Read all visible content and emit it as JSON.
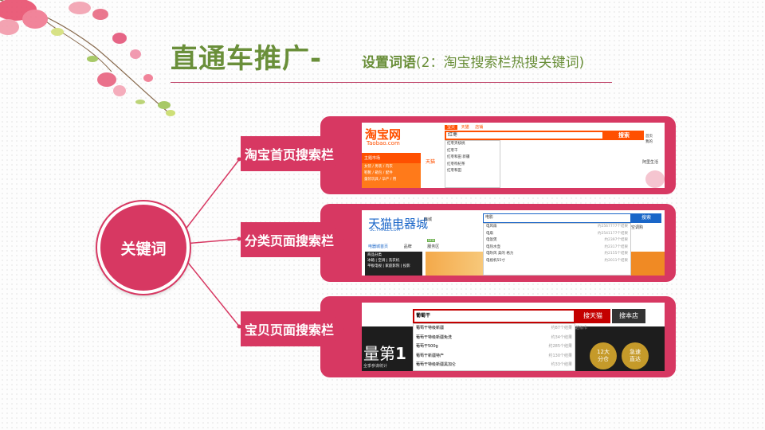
{
  "title": "直通车推广-",
  "subtitle": {
    "bold": "设置词语",
    "rest": "(2：淘宝搜索栏热搜关键词)"
  },
  "center": "关键词",
  "branches": [
    {
      "label": "淘宝首页搜索栏"
    },
    {
      "label": "分类页面搜索栏"
    },
    {
      "label": "宝贝页面搜索栏"
    }
  ],
  "shot1": {
    "logo": "淘宝网",
    "logo_sub": "Taobao.com",
    "tabs": [
      "宝贝",
      "天猫",
      "店铺"
    ],
    "query": "红枣",
    "button": "搜索",
    "side_title": "主题市场",
    "tmall": "天猫",
    "menu": [
      "女装 / 男装 / 内衣",
      "鞋靴 / 箱包 / 配件",
      "童装玩具 / 孕产 / 用"
    ],
    "suggestions": [
      "红枣夹核桃",
      "红枣干",
      "红枣和田 新疆",
      "红枣枸杞茶",
      "红枣和田"
    ],
    "right": [
      "首页",
      "我的"
    ],
    "right2": "阿里生活"
  },
  "shot2": {
    "logo": "天猫电器城",
    "logo_sub": "3C.TMALL.COM",
    "city": "商城",
    "query": "电影",
    "button": "搜索",
    "nav": [
      "电器城首页",
      "品牌",
      "服务区"
    ],
    "new_badge": "NEW",
    "side": "商品分类",
    "cats": [
      "冰箱 | 空调 | 洗衣机",
      "平板电视 | 家庭影院 | 投影"
    ],
    "suggestions": [
      {
        "term": "电风扇",
        "count": "约2567777个结果"
      },
      {
        "term": "电扇",
        "count": "约2541177个结果"
      },
      {
        "term": "电饭煲",
        "count": "约2397个结果"
      },
      {
        "term": "电热水壶",
        "count": "约2317个结果"
      },
      {
        "term": "电吹风 美的 格力",
        "count": "约2155个结果"
      },
      {
        "term": "电视机55寸",
        "count": "约2011个结果"
      }
    ],
    "right": "空调购"
  },
  "shot3": {
    "query": "葡萄干",
    "btn1": "搜天猫",
    "btn2": "搜本店",
    "suggestions": [
      {
        "term": "葡萄干特级新疆",
        "count": "约87个结果"
      },
      {
        "term": "葡萄干特级新疆免洗",
        "count": "约34个结果"
      },
      {
        "term": "葡萄干500g",
        "count": "约285个结果"
      },
      {
        "term": "葡萄干新疆特产",
        "count": "约130个结果"
      },
      {
        "term": "葡萄干特级新疆黑加仑",
        "count": "约33个结果"
      }
    ],
    "extra": "超级市",
    "big": "量第",
    "big_num": "1",
    "caption": "全季参谋统计",
    "badge1": "12大\n分仓",
    "badge2": "急速\n直达"
  }
}
